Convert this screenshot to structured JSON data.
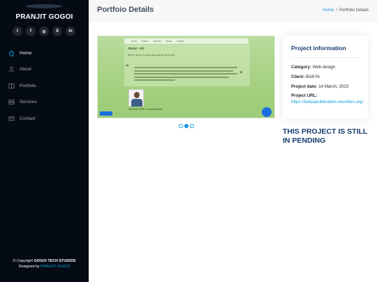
{
  "sidebar": {
    "name": "PRANJIT GOGOI",
    "socials": [
      {
        "icon": "twitter-icon",
        "glyph": "t"
      },
      {
        "icon": "facebook-icon",
        "glyph": "f"
      },
      {
        "icon": "instagram-icon",
        "glyph": "◎"
      },
      {
        "icon": "skype-icon",
        "glyph": "S"
      },
      {
        "icon": "linkedin-icon",
        "glyph": "in"
      }
    ],
    "nav": [
      {
        "label": "Home",
        "icon": "home-icon"
      },
      {
        "label": "About",
        "icon": "person-icon"
      },
      {
        "label": "Portfolio",
        "icon": "book-icon"
      },
      {
        "label": "Services",
        "icon": "server-icon"
      },
      {
        "label": "Contact",
        "icon": "envelope-icon"
      }
    ],
    "footer": {
      "copyright_prefix": "© Copyright",
      "studio": "GOGOI TECH STUDIOS",
      "designed_prefix": "Designed by",
      "designer": "PRANJIT GOGOI"
    }
  },
  "header": {
    "title": "Portfoio Details",
    "breadcrumb": {
      "home": "Home",
      "separator": "/",
      "current": "Portfolio Details"
    }
  },
  "slide": {
    "nav_items": [
      "Home",
      "Gallery",
      "Services",
      "About",
      "Contact"
    ],
    "about": "About - US",
    "sub": "BAKYA: Where Creative Ideas Flourish Since 2017",
    "founder": "SATYAJIT NATH - Founder/Owner",
    "slider": {
      "count": 3,
      "active": 2
    }
  },
  "project_info": {
    "title": "Project information",
    "category_label": "Category",
    "category": "Web design",
    "client_label": "Client",
    "client": "BAKYA",
    "date_label": "Project date",
    "date": "14 March, 2023",
    "url_label": "Project URL",
    "url": "https://bakyapublication.neocities.org/"
  },
  "status": "THIS PROJECT IS STILL IN PENDING",
  "colors": {
    "accent": "#149ddd",
    "sidebar": "#040b14",
    "heading": "#173b6c"
  }
}
